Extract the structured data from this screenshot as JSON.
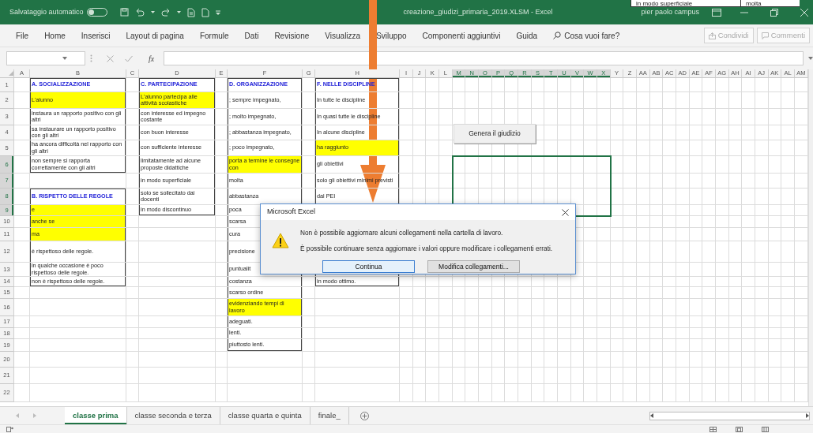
{
  "title_bar": {
    "autosave_label": "Salvataggio automatico",
    "autosave_on": false,
    "title": "creazione_giudizi_primaria_2019.XLSM - Excel",
    "snippet": [
      "in modo superficiale",
      "molta"
    ],
    "user": "pier paolo campus"
  },
  "menu": {
    "tabs": [
      {
        "label": "File",
        "selected": false
      },
      {
        "label": "Home",
        "selected": false
      },
      {
        "label": "Inserisci",
        "selected": false
      },
      {
        "label": "Layout di pagina",
        "selected": false
      },
      {
        "label": "Formule",
        "selected": false
      },
      {
        "label": "Dati",
        "selected": false
      },
      {
        "label": "Revisione",
        "selected": false
      },
      {
        "label": "Visualizza",
        "selected": false
      },
      {
        "label": "Sviluppo",
        "selected": false
      },
      {
        "label": "Componenti aggiuntivi",
        "selected": false
      },
      {
        "label": "Guida",
        "selected": false
      }
    ],
    "tell_me": "Cosa vuoi fare?",
    "share": "Condividi",
    "comments": "Commenti"
  },
  "formula_bar": {
    "fx": "fx"
  },
  "columns": [
    {
      "label": "A",
      "selected": false
    },
    {
      "label": "B",
      "selected": false
    },
    {
      "label": "C",
      "selected": false
    },
    {
      "label": "D",
      "selected": false
    },
    {
      "label": "E",
      "selected": false
    },
    {
      "label": "F",
      "selected": false
    },
    {
      "label": "G",
      "selected": false
    },
    {
      "label": "H",
      "selected": false
    },
    {
      "label": "I",
      "selected": false
    },
    {
      "label": "J",
      "selected": false
    },
    {
      "label": "K",
      "selected": false
    },
    {
      "label": "L",
      "selected": false
    },
    {
      "label": "M",
      "selected": true
    },
    {
      "label": "N",
      "selected": true
    },
    {
      "label": "O",
      "selected": true
    },
    {
      "label": "P",
      "selected": true
    },
    {
      "label": "Q",
      "selected": true
    },
    {
      "label": "R",
      "selected": true
    },
    {
      "label": "S",
      "selected": true
    },
    {
      "label": "T",
      "selected": true
    },
    {
      "label": "U",
      "selected": true
    },
    {
      "label": "V",
      "selected": true
    },
    {
      "label": "W",
      "selected": true
    },
    {
      "label": "X",
      "selected": true
    },
    {
      "label": "Y",
      "selected": false
    },
    {
      "label": "Z",
      "selected": false
    },
    {
      "label": "AA",
      "selected": false
    },
    {
      "label": "AB",
      "selected": false
    },
    {
      "label": "AC",
      "selected": false
    },
    {
      "label": "AD",
      "selected": false
    },
    {
      "label": "AE",
      "selected": false
    },
    {
      "label": "AF",
      "selected": false
    },
    {
      "label": "AG",
      "selected": false
    },
    {
      "label": "AH",
      "selected": false
    },
    {
      "label": "AI",
      "selected": false
    },
    {
      "label": "AJ",
      "selected": false
    },
    {
      "label": "AK",
      "selected": false
    },
    {
      "label": "AL",
      "selected": false
    },
    {
      "label": "AM",
      "selected": false
    }
  ],
  "rows": [
    {
      "label": "1",
      "selected": false,
      "b": {
        "text": "A. SOCIALIZZAZIONE",
        "kind": "heading"
      },
      "d": {
        "text": "C. PARTECIPAZIONE",
        "kind": "heading"
      },
      "f": {
        "text": "D. ORGANIZZAZIONE",
        "kind": "heading"
      },
      "h": {
        "text": "F. NELLE DISCIPLINE",
        "kind": "heading"
      }
    },
    {
      "label": "2",
      "selected": false,
      "b": {
        "text": "L'alunno",
        "kind": "highlight"
      },
      "d": {
        "text": "L'alunno partecipa alle attività scolastiche",
        "kind": "highlight"
      },
      "f": {
        "text": "; sempre impegnato,",
        "kind": "plain"
      },
      "h": {
        "text": "In tutte le discipline",
        "kind": "plain"
      }
    },
    {
      "label": "3",
      "selected": false,
      "b": {
        "text": "instaura un rapporto positivo con gli altri",
        "kind": "plain"
      },
      "d": {
        "text": "con interesse ed impegno costante",
        "kind": "plain"
      },
      "f": {
        "text": "; molto impegnato,",
        "kind": "plain"
      },
      "h": {
        "text": "In quasi tutte le discipline",
        "kind": "plain"
      }
    },
    {
      "label": "4",
      "selected": false,
      "b": {
        "text": "sa instaurare un rapporto positivo con gli altri",
        "kind": "plain"
      },
      "d": {
        "text": "con buon interesse",
        "kind": "plain"
      },
      "f": {
        "text": "; abbastanza impegnato,",
        "kind": "plain"
      },
      "h": {
        "text": "In alcune discipline",
        "kind": "plain"
      }
    },
    {
      "label": "5",
      "selected": false,
      "b": {
        "text": "ha ancora difficoltà nel rapporto con gli altri",
        "kind": "plain"
      },
      "d": {
        "text": "con sufficiente interesse",
        "kind": "plain"
      },
      "f": {
        "text": "; poco impegnato,",
        "kind": "plain"
      },
      "h": {
        "text": "ha raggiunto",
        "kind": "highlight"
      }
    },
    {
      "label": "6",
      "selected": true,
      "b": {
        "text": "non sempre si rapporta correttamente con gli altri",
        "kind": "plain"
      },
      "d": {
        "text": "limitatamente ad alcune proposte didattiche",
        "kind": "plain"
      },
      "f": {
        "text": "porta a termine le consegne con",
        "kind": "highlight"
      },
      "h": {
        "text": "gli obiettivi",
        "kind": "plain"
      }
    },
    {
      "label": "7",
      "selected": true,
      "d": {
        "text": "in modo superficiale",
        "kind": "plain"
      },
      "f": {
        "text": "molta",
        "kind": "plain"
      },
      "h": {
        "text": "solo gli obiettivi minimi previsti",
        "kind": "plain"
      }
    },
    {
      "label": "8",
      "selected": true,
      "b": {
        "text": "B. RISPETTO DELLE REGOLE",
        "kind": "heading"
      },
      "d": {
        "text": "solo se sollecitato dai docenti",
        "kind": "plain"
      },
      "f": {
        "text": "abbastanza",
        "kind": "plain"
      },
      "h": {
        "text": "dal PEI",
        "kind": "plain"
      }
    },
    {
      "label": "9",
      "selected": true,
      "b": {
        "text": "e",
        "kind": "highlight"
      },
      "d": {
        "text": "in modo discontinuo",
        "kind": "plain"
      },
      "f": {
        "text": "poca",
        "kind": "plain"
      }
    },
    {
      "label": "10",
      "selected": false,
      "b": {
        "text": "anche se",
        "kind": "highlight"
      },
      "f": {
        "text": "scarsa",
        "kind": "plain"
      }
    },
    {
      "label": "11",
      "selected": false,
      "b": {
        "text": "ma",
        "kind": "highlight"
      },
      "f": {
        "text": "cura",
        "kind": "plain"
      }
    },
    {
      "label": "12",
      "selected": false,
      "b": {
        "text": "è rispettoso delle regole.",
        "kind": "plain"
      },
      "f": {
        "text": "precisione",
        "kind": "plain"
      }
    },
    {
      "label": "13",
      "selected": false,
      "b": {
        "text": "in qualche occasione è poco rispettoso delle regole.",
        "kind": "plain"
      },
      "f": {
        "text": "puntualit",
        "kind": "plain"
      }
    },
    {
      "label": "14",
      "selected": false,
      "b": {
        "text": "non è rispettoso delle regole.",
        "kind": "plain"
      },
      "f": {
        "text": "costanza",
        "kind": "plain"
      },
      "h": {
        "text": "in modo ottimo.",
        "kind": "plain"
      }
    },
    {
      "label": "15",
      "selected": false,
      "f": {
        "text": "scarso ordine",
        "kind": "plain"
      }
    },
    {
      "label": "16",
      "selected": false,
      "f": {
        "text": "evidenziando tempi di lavoro",
        "kind": "highlight"
      }
    },
    {
      "label": "17",
      "selected": false,
      "f": {
        "text": "adeguati.",
        "kind": "plain"
      }
    },
    {
      "label": "18",
      "selected": false,
      "f": {
        "text": "lenti.",
        "kind": "plain"
      }
    },
    {
      "label": "19",
      "selected": false,
      "f": {
        "text": "piuttosto lenti.",
        "kind": "plain"
      }
    },
    {
      "label": "20",
      "selected": false
    },
    {
      "label": "21",
      "selected": false
    },
    {
      "label": "22",
      "selected": false
    }
  ],
  "form_button": "Genera il giudizio",
  "dialog": {
    "title": "Microsoft Excel",
    "messages": [
      "Non è possibile aggiornare alcuni collegamenti nella cartella di lavoro.",
      "È possibile continuare senza aggiornare i valori oppure modificare i collegamenti errati."
    ],
    "buttons": [
      {
        "label": "Continua",
        "default": true
      },
      {
        "label": "Modifica collegamenti...",
        "default": false
      }
    ]
  },
  "sheet_tabs": [
    {
      "label": "classe prima",
      "selected": true
    },
    {
      "label": "classe seconda e terza",
      "selected": false
    },
    {
      "label": "classe quarta e quinta",
      "selected": false
    },
    {
      "label": "finale_",
      "selected": false
    }
  ]
}
